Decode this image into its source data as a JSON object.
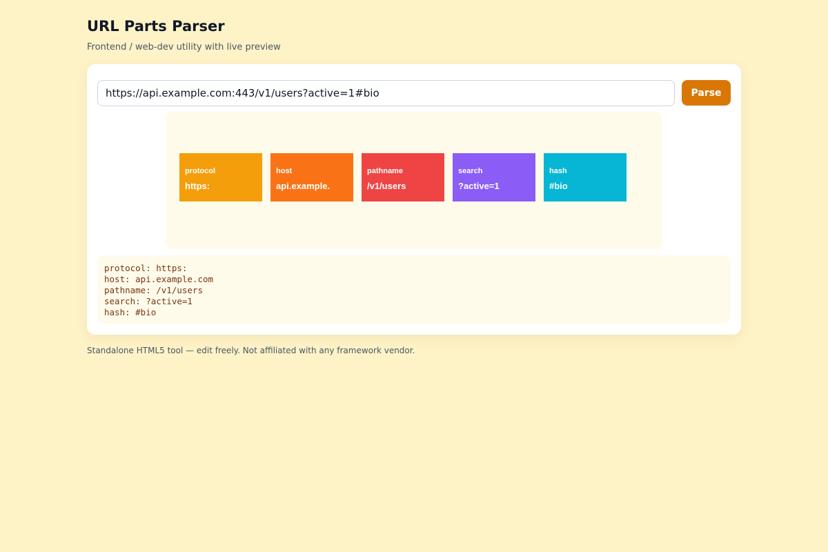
{
  "header": {
    "title": "URL Parts Parser",
    "subtitle": "Frontend / web-dev utility with live preview"
  },
  "input": {
    "url_value": "https://api.example.com:443/v1/users?active=1#bio",
    "parse_label": "Parse"
  },
  "preview": {
    "parts": [
      {
        "label": "protocol",
        "value": "https:",
        "color": "#f59e0b"
      },
      {
        "label": "host",
        "value": "api.example.",
        "color": "#f97316"
      },
      {
        "label": "pathname",
        "value": "/v1/users",
        "color": "#ef4444"
      },
      {
        "label": "search",
        "value": "?active=1",
        "color": "#8b5cf6"
      },
      {
        "label": "hash",
        "value": "#bio",
        "color": "#06b6d4"
      }
    ]
  },
  "output": {
    "lines": [
      "protocol: https:",
      "host: api.example.com",
      "pathname: /v1/users",
      "search: ?active=1",
      "hash: #bio"
    ]
  },
  "footer": {
    "text": "Standalone HTML5 tool — edit freely. Not affiliated with any framework vendor."
  },
  "colors": {
    "background": "#fef3c7",
    "accent": "#d97706"
  }
}
